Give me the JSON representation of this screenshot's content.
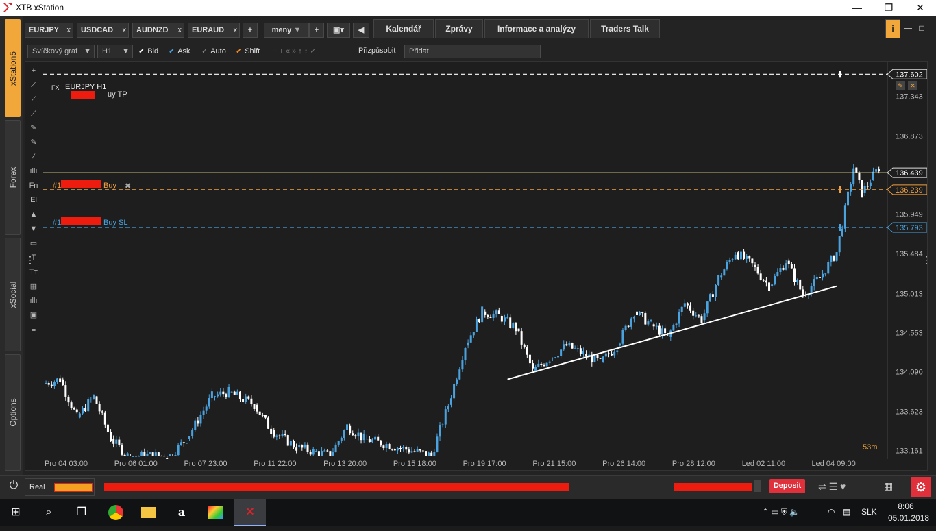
{
  "window": {
    "title": "XTB xStation"
  },
  "rail": {
    "tabs": [
      "xStation5",
      "Forex",
      "xSocial",
      "Options"
    ]
  },
  "symbol_tabs": [
    "EURJPY",
    "USDCAD",
    "AUDNZD",
    "EURAUD"
  ],
  "tabbar": {
    "plus": "+",
    "group_label": "meny"
  },
  "menu": [
    "Kalendář",
    "Zprávy",
    "Informace a analýzy",
    "Traders Talk"
  ],
  "toolbar": {
    "chart_type": "Svíčkový graf",
    "timeframe": "H1",
    "bid": "Bid",
    "ask": "Ask",
    "auto": "Auto",
    "shift": "Shift",
    "fit": "Přizpůsobit",
    "add_input": "Přidat"
  },
  "drawtools": [
    "+",
    "⟋",
    "⟋",
    "⟋",
    "✎",
    "✎",
    "⁄",
    "ıllı",
    "Fn",
    "El",
    "▲",
    "▼",
    "▭",
    "T",
    "Tт",
    "▦",
    "ıllı",
    "▣",
    "≡"
  ],
  "chart_header": {
    "fx_label": "FX",
    "symbol": "EURJPY H1"
  },
  "orders": {
    "tp_text": "uy  TP",
    "buy_text": "Buy",
    "sl_text": "Buy  SL",
    "prefix": "#1"
  },
  "price_tags": {
    "tp": "137.602",
    "current": "136.439",
    "entry": "136.239",
    "sl": "135.793"
  },
  "countdown": "53m",
  "bottom": {
    "account_type": "Real",
    "deposit_label": "Deposit"
  },
  "taskbar": {
    "time": "8:06",
    "date": "05.01.2018",
    "lang": "SLK"
  },
  "colors": {
    "accent": "#f2a73b",
    "bull": "#4aa3df",
    "bear": "#ffffff",
    "tp_line": "#ffffff",
    "entry": "#f0a040",
    "sl": "#4aa3df",
    "deposit": "#e0303c"
  },
  "chart_data": {
    "type": "candlestick",
    "y_ticks": [
      137.343,
      136.873,
      135.949,
      135.484,
      135.013,
      134.553,
      134.09,
      133.623,
      133.161
    ],
    "x_ticks": [
      "Pro 04 03:00",
      "Pro 06 01:00",
      "Pro 07 23:00",
      "Pro 11 22:00",
      "Pro 13 20:00",
      "Pro 15 18:00",
      "Pro 19 17:00",
      "Pro 21 15:00",
      "Pro 26 14:00",
      "Pro 28 12:00",
      "Led 02 11:00",
      "Led 04 09:00"
    ],
    "ylim": [
      133.1,
      137.75
    ],
    "levels": {
      "tp": 137.602,
      "current": 136.439,
      "entry": 136.239,
      "sl": 135.793
    },
    "trendline": [
      [
        0.55,
        134.0
      ],
      [
        0.94,
        135.1
      ]
    ],
    "price_path": [
      [
        0.0,
        133.95
      ],
      [
        0.02,
        134.0
      ],
      [
        0.04,
        133.55
      ],
      [
        0.06,
        133.8
      ],
      [
        0.08,
        133.3
      ],
      [
        0.1,
        133.1
      ],
      [
        0.15,
        133.1
      ],
      [
        0.17,
        133.3
      ],
      [
        0.2,
        133.8
      ],
      [
        0.22,
        133.85
      ],
      [
        0.25,
        133.7
      ],
      [
        0.27,
        133.4
      ],
      [
        0.3,
        133.2
      ],
      [
        0.32,
        133.15
      ],
      [
        0.34,
        133.1
      ],
      [
        0.36,
        133.45
      ],
      [
        0.38,
        133.3
      ],
      [
        0.46,
        133.1
      ],
      [
        0.48,
        133.7
      ],
      [
        0.5,
        134.4
      ],
      [
        0.52,
        134.8
      ],
      [
        0.54,
        134.75
      ],
      [
        0.56,
        134.6
      ],
      [
        0.58,
        134.1
      ],
      [
        0.6,
        134.25
      ],
      [
        0.62,
        134.4
      ],
      [
        0.64,
        134.3
      ],
      [
        0.66,
        134.2
      ],
      [
        0.68,
        134.4
      ],
      [
        0.7,
        134.8
      ],
      [
        0.72,
        134.65
      ],
      [
        0.74,
        134.5
      ],
      [
        0.76,
        134.9
      ],
      [
        0.78,
        134.7
      ],
      [
        0.8,
        135.2
      ],
      [
        0.82,
        135.5
      ],
      [
        0.84,
        135.35
      ],
      [
        0.86,
        135.1
      ],
      [
        0.88,
        135.4
      ],
      [
        0.9,
        135.0
      ],
      [
        0.92,
        135.2
      ],
      [
        0.94,
        135.5
      ],
      [
        0.96,
        136.5
      ],
      [
        0.97,
        136.2
      ],
      [
        0.98,
        136.35
      ],
      [
        0.99,
        136.5
      ]
    ]
  }
}
